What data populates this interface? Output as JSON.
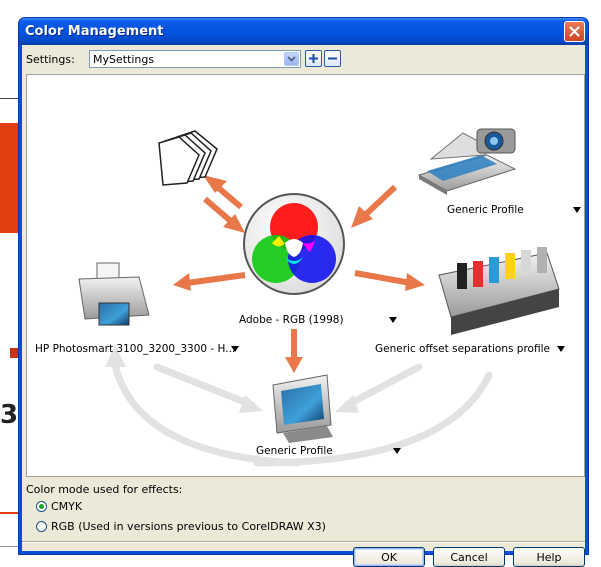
{
  "window": {
    "title": "Color Management"
  },
  "settings": {
    "label": "Settings:",
    "value": "MySettings"
  },
  "devices": {
    "center": "Adobe - RGB (1998)",
    "scanner": "Generic Profile",
    "printer": "HP Photosmart 3100_3200_3300 - H...",
    "press": "Generic offset separations profile",
    "monitor": "Generic Profile"
  },
  "mode": {
    "label": "Color mode used for effects:",
    "options": [
      "CMYK",
      "RGB (Used in versions previous to CorelDRAW X3)"
    ],
    "selected": "CMYK"
  },
  "buttons": {
    "ok": "OK",
    "cancel": "Cancel",
    "help": "Help"
  },
  "background": {
    "digit": "3"
  },
  "colors": {
    "arrow": "#e8784a",
    "titlebar": "#0a4fd6",
    "face": "#ece9d8",
    "bgRed": "#e33e12"
  }
}
